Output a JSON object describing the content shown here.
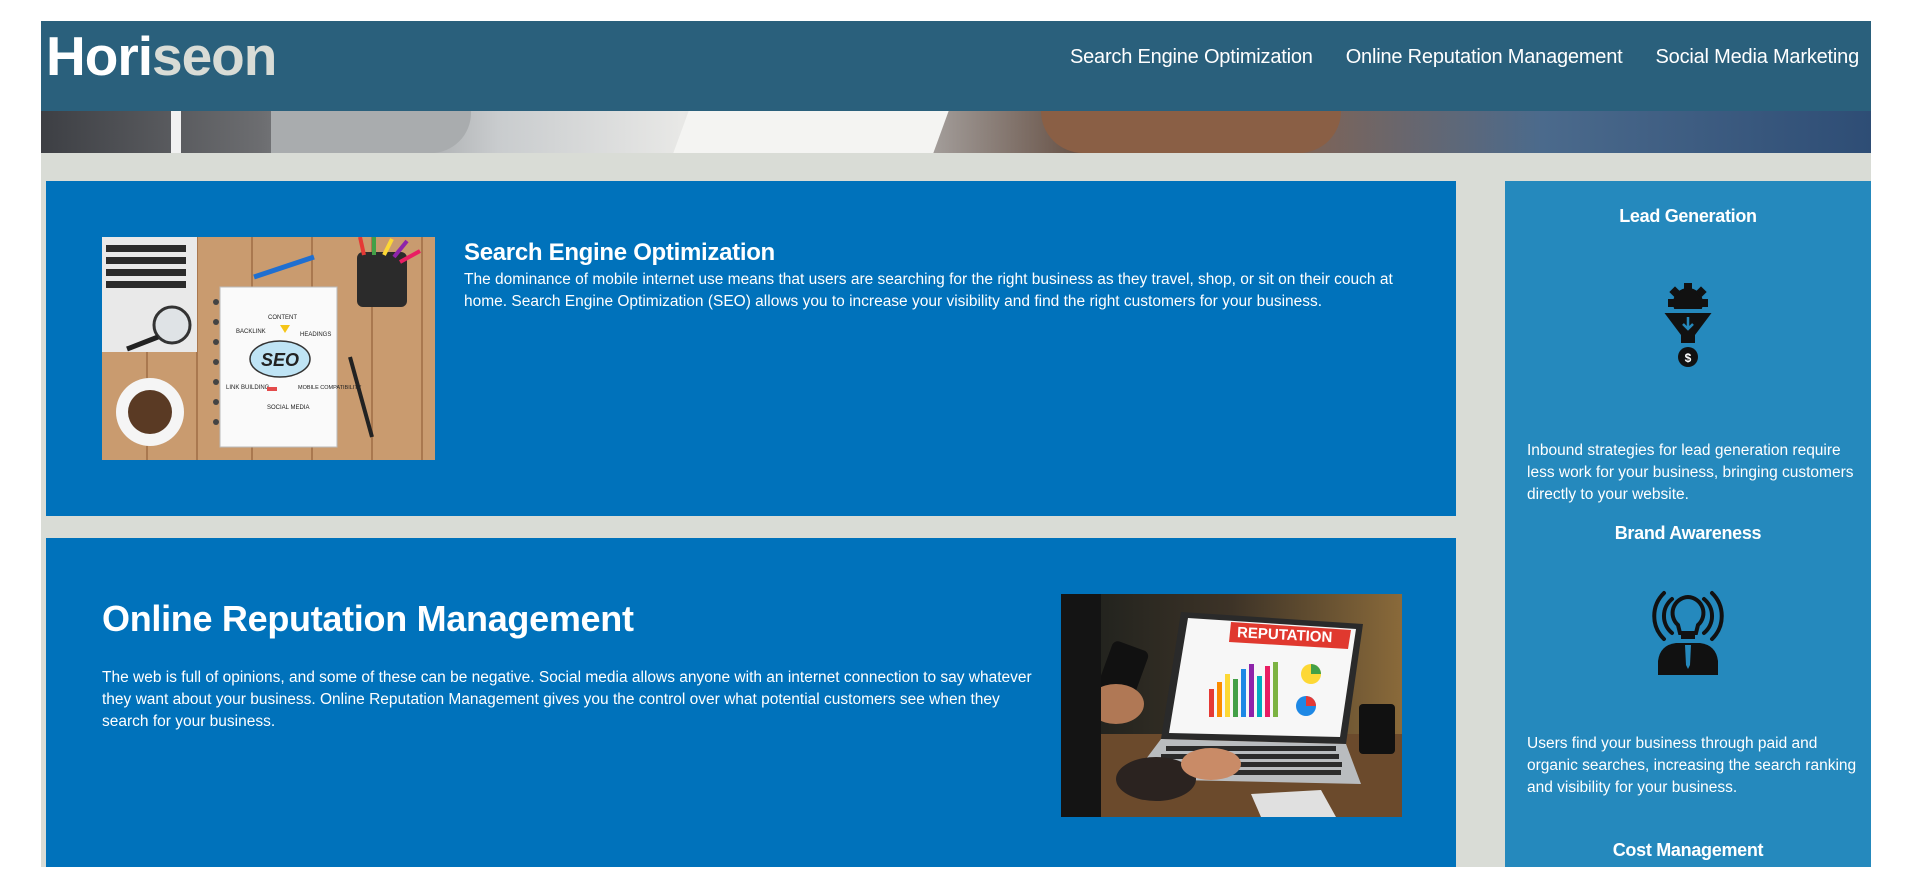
{
  "header": {
    "logo_main": "Hori",
    "logo_accent": "seon",
    "nav": [
      {
        "label": "Search Engine Optimization"
      },
      {
        "label": "Online Reputation Management"
      },
      {
        "label": "Social Media Marketing"
      }
    ]
  },
  "content": {
    "seo": {
      "title": "Search Engine Optimization",
      "body": "The dominance of mobile internet use means that users are searching for the right business as they travel, shop, or sit on their couch at home. Search Engine Optimization (SEO) allows you to increase your visibility and find the right customers for your business.",
      "image_labels": {
        "center": "SEO",
        "content": "CONTENT",
        "backlink": "BACKLINK",
        "headings": "HEADINGS",
        "link_building": "LINK BUILDING",
        "mobile": "MOBILE COMPATIBILITY",
        "social": "SOCIAL MEDIA"
      }
    },
    "orm": {
      "title": "Online Reputation Management",
      "body": "The web is full of opinions, and some of these can be negative. Social media allows anyone with an internet connection to say whatever they want about your business. Online Reputation Management gives you the control over what potential customers see when they search for your business.",
      "image_label": "REPUTATION"
    }
  },
  "benefits": [
    {
      "title": "Lead Generation",
      "icon": "lead-generation-icon",
      "body": "Inbound strategies for lead generation require less work for your business, bringing customers directly to your website."
    },
    {
      "title": "Brand Awareness",
      "icon": "brand-awareness-icon",
      "body": "Users find your business through paid and organic searches, increasing the search ranking and visibility for your business."
    },
    {
      "title": "Cost Management",
      "icon": "cost-management-icon"
    }
  ],
  "colors": {
    "header_bg": "#2a607c",
    "page_bg": "#d9dcd6",
    "content_bg": "#0072bb",
    "benefits_bg": "#2589bd",
    "logo_accent": "#d9dcd6"
  }
}
